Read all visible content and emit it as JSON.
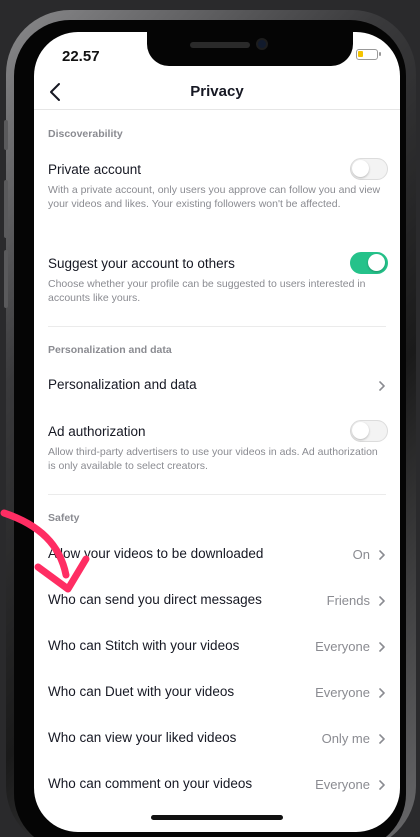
{
  "status": {
    "time": "22.57"
  },
  "nav": {
    "title": "Privacy"
  },
  "sections": {
    "discoverability": "Discoverability",
    "personalization": "Personalization and data",
    "safety": "Safety"
  },
  "private_account": {
    "title": "Private account",
    "desc": "With a private account, only users you approve can follow you and view your videos and likes. Your existing followers won't be affected.",
    "enabled": false
  },
  "suggest_account": {
    "title": "Suggest your account to others",
    "desc": "Choose whether your profile can be suggested to users interested in accounts like yours.",
    "enabled": true
  },
  "personalization_item": {
    "title": "Personalization and data"
  },
  "ad_authorization": {
    "title": "Ad authorization",
    "desc": "Allow third-party advertisers to use your videos in ads. Ad authorization is only available to select creators.",
    "enabled": false
  },
  "safety_items": [
    {
      "title": "Allow your videos to be downloaded",
      "value": "On"
    },
    {
      "title": "Who can send you direct messages",
      "value": "Friends"
    },
    {
      "title": "Who can Stitch with your videos",
      "value": "Everyone"
    },
    {
      "title": "Who can Duet with your videos",
      "value": "Everyone"
    },
    {
      "title": "Who can view your liked videos",
      "value": "Only me"
    },
    {
      "title": "Who can comment on your videos",
      "value": "Everyone"
    }
  ],
  "colors": {
    "toggle_on": "#25c28a",
    "arrow": "#ff2d63",
    "battery": "#f5c400"
  }
}
